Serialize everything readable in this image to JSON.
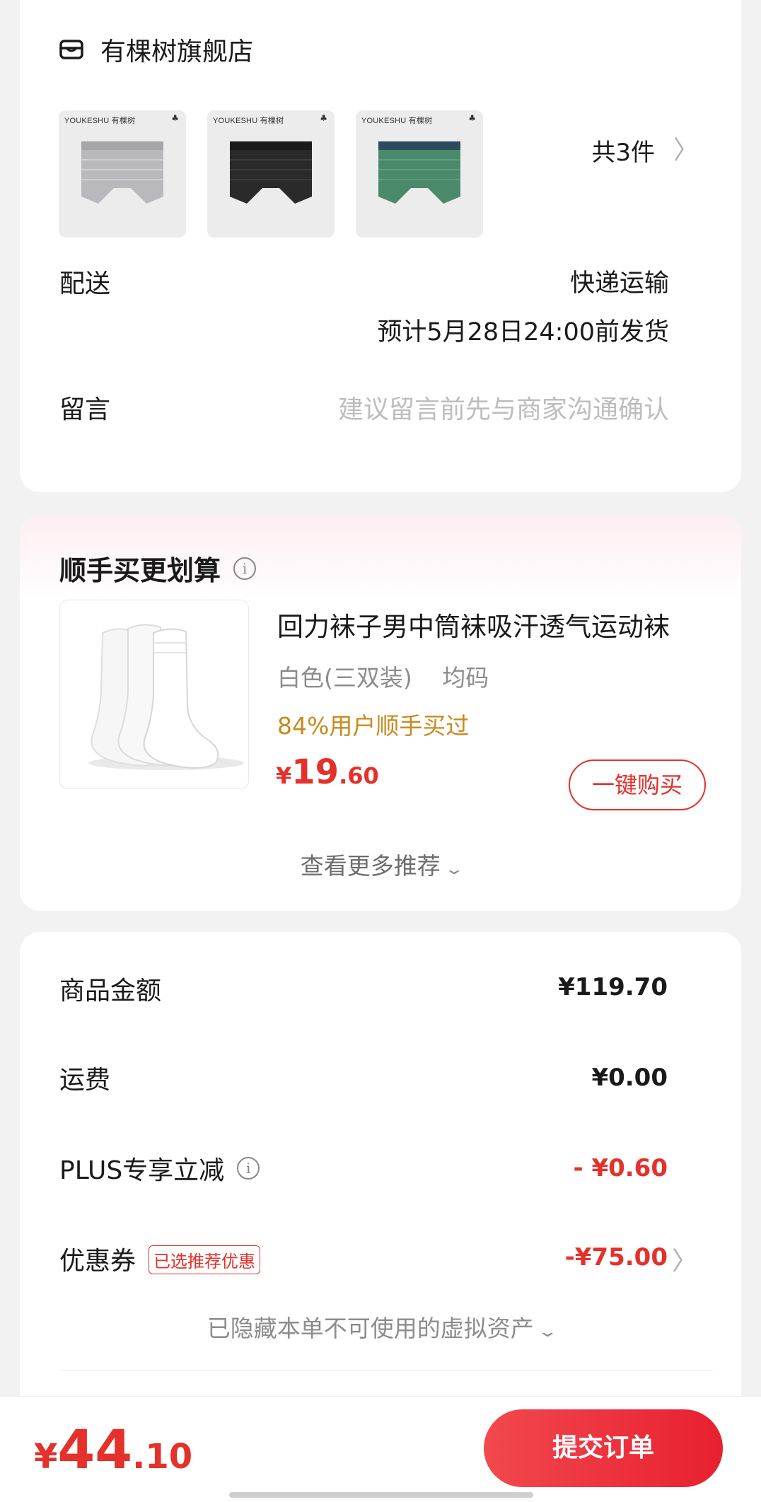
{
  "shop": {
    "name": "有棵树旗舰店",
    "thumb_brand": "YOUKESHU 有棵树",
    "products": [
      {
        "color": "#b9b9bd",
        "band": "#a5a5aa"
      },
      {
        "color": "#2a2a2a",
        "band": "#1a1a1a"
      },
      {
        "color": "#4a8a6a",
        "band": "#2d4b5e"
      }
    ],
    "count_text": "共3件",
    "delivery_label": "配送",
    "delivery_method": "快递运输",
    "delivery_eta": "预计5月28日24:00前发货",
    "remark_label": "留言",
    "remark_placeholder": "建议留言前先与商家沟通确认"
  },
  "upsell": {
    "title": "顺手买更划算",
    "product_name": "回力袜子男中筒袜吸汗透气运动袜",
    "spec_color": "白色(三双装)",
    "spec_size": "均码",
    "bought_text": "84%用户顺手买过",
    "price_symbol": "¥",
    "price_int": "19",
    "price_dec": ".60",
    "buy_label": "一键购买",
    "more_label": "查看更多推荐"
  },
  "price_summary": {
    "goods_label": "商品金额",
    "goods_value": "¥119.70",
    "shipping_label": "运费",
    "shipping_value": "¥0.00",
    "plus_label": "PLUS专享立减",
    "plus_value": "- ¥0.60",
    "coupon_label": "优惠券",
    "coupon_tag": "已选推荐优惠",
    "coupon_value": "-¥75.00",
    "hidden_assets": "已隐藏本单不可使用的虚拟资产"
  },
  "bottom": {
    "total_symbol": "¥",
    "total_int": "44",
    "total_dec": ".10",
    "submit_label": "提交订单"
  },
  "colors": {
    "accent_red": "#e4312b",
    "bought_gold": "#c98a1e"
  }
}
